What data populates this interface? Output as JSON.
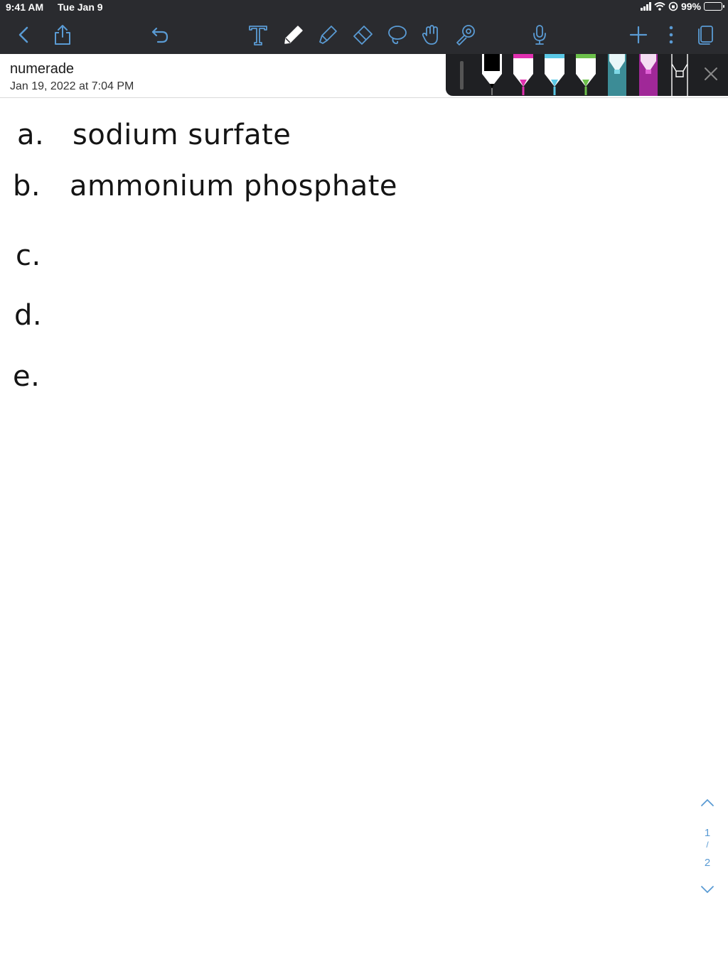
{
  "status_bar": {
    "time": "9:41 AM",
    "date": "Tue Jan 9",
    "battery": "99%",
    "icons": [
      "signal-icon",
      "wifi-icon",
      "orientation-lock-icon",
      "battery-icon"
    ]
  },
  "toolbar": {
    "tools": [
      "back-icon",
      "share-icon",
      "undo-icon",
      "text-tool-icon",
      "pen-icon",
      "highlighter-icon",
      "eraser-icon",
      "lasso-icon",
      "hand-tool-icon",
      "laser-pointer-icon",
      "microphone-icon",
      "add-page-icon",
      "more-icon",
      "pages-icon"
    ],
    "accent_color": "#5a9bd4"
  },
  "document": {
    "title": "numerade",
    "date": "Jan 19, 2022 at 7:04 PM"
  },
  "pen_palette": {
    "pens": [
      {
        "name": "thin-pen",
        "color": "#2a2a2a"
      },
      {
        "name": "black-pen",
        "color": "#000000"
      },
      {
        "name": "magenta-pen",
        "color": "#e030b0"
      },
      {
        "name": "sky-pen",
        "color": "#5bc8e6"
      },
      {
        "name": "green-pen",
        "color": "#6cc04a"
      },
      {
        "name": "teal-highlighter",
        "color": "#3c8c96"
      },
      {
        "name": "purple-highlighter",
        "color": "#a02898"
      },
      {
        "name": "outline-highlighter",
        "color": "#1f2023"
      }
    ],
    "close_icon": "close-icon"
  },
  "notes": [
    {
      "label": "a.",
      "text": "sodium surfate"
    },
    {
      "label": "b.",
      "text": "ammonium phosphate"
    },
    {
      "label": "c.",
      "text": ""
    },
    {
      "label": "d.",
      "text": ""
    },
    {
      "label": "e.",
      "text": ""
    }
  ],
  "page_nav": {
    "current": "1",
    "separator": "/",
    "total": "2"
  }
}
